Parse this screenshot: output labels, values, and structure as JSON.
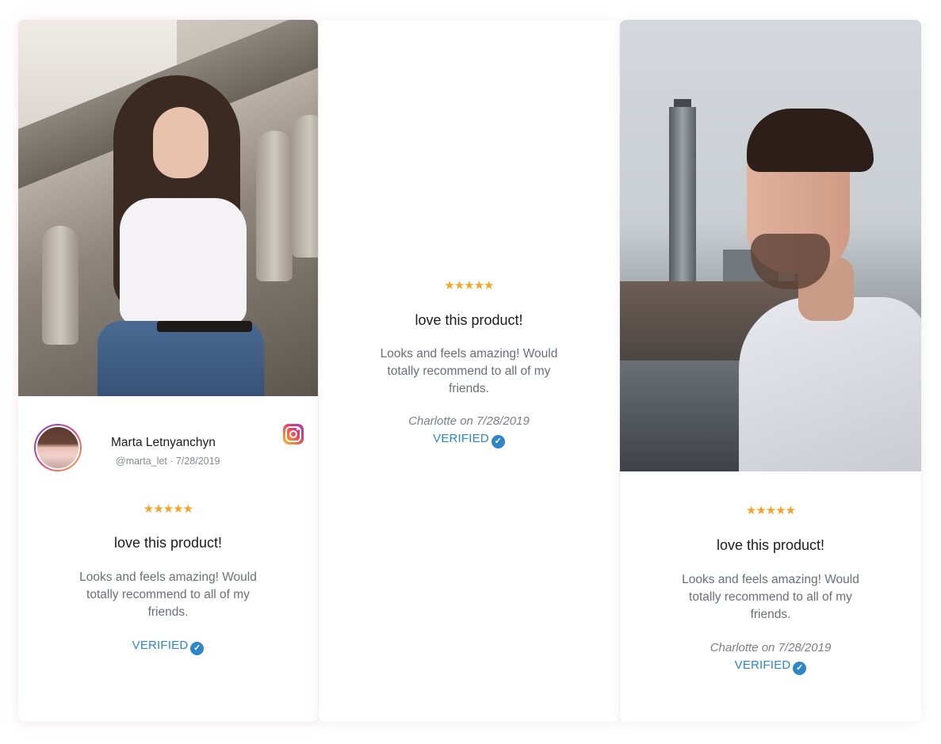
{
  "colors": {
    "star": "#f2a52c",
    "verified": "#2e86c7",
    "title": "#1b1b1b",
    "body": "#6b6e73"
  },
  "cards": [
    {
      "author_name": "Marta Letnyanchyn",
      "author_handle": "@marta_let · 7/28/2019",
      "source_icon": "instagram-icon",
      "rating": "★★★★★",
      "title": "love this product!",
      "body": "Looks and feels amazing! Would totally recommend to all of my friends.",
      "verified": "VERIFIED"
    },
    {
      "rating": "★★★★★",
      "title": "love this product!",
      "body": "Looks and feels amazing! Would totally recommend to all of my friends.",
      "reviewer_line": "Charlotte on 7/28/2019",
      "verified": "VERIFIED"
    },
    {
      "rating": "★★★★★",
      "title": "love this product!",
      "body": "Looks and feels amazing! Would totally recommend to all of my friends.",
      "reviewer_line": "Charlotte on 7/28/2019",
      "verified": "VERIFIED"
    }
  ]
}
